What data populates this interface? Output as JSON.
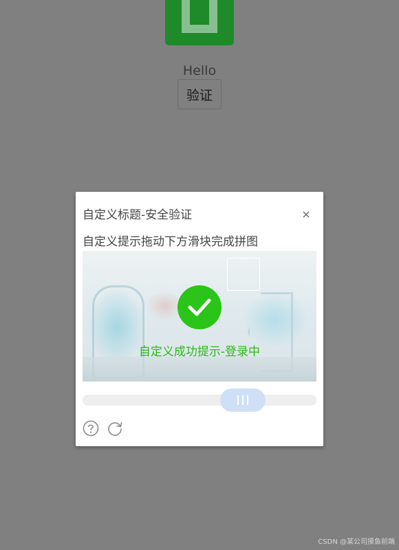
{
  "page": {
    "hello_text": "Hello",
    "verify_button_label": "验证"
  },
  "dialog": {
    "title": "自定义标题-安全验证",
    "close_icon": "close-icon",
    "hint": "自定义提示拖动下方滑块完成拼图",
    "success_icon": "check-circle-icon",
    "success_text": "自定义成功提示-登录中",
    "slider_progress": 0.73,
    "footer_icons": [
      "help-icon",
      "refresh-icon"
    ]
  },
  "watermark": "CSDN @某公司摸鱼前端",
  "colors": {
    "overlay": "#808080",
    "success_green": "#2bc419",
    "logo_green": "#1e8a2a",
    "slider_knob": "#cfe0f6"
  }
}
